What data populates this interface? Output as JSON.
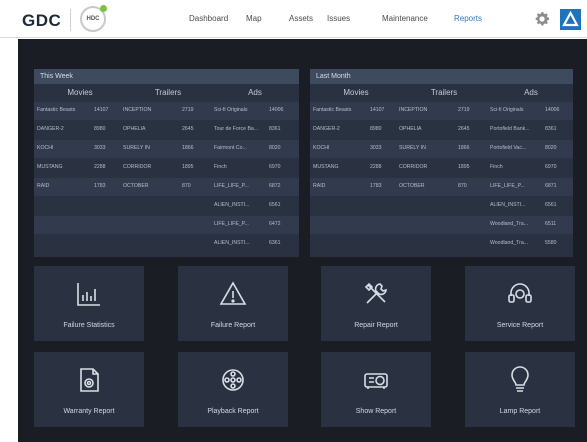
{
  "header": {
    "logo": "GDC",
    "badge": "HDC",
    "nav": [
      "Dashboard",
      "Map",
      "Assets",
      "Issues",
      "Maintenance",
      "Reports"
    ],
    "active_nav": "Reports"
  },
  "this_week": {
    "title": "This Week",
    "columns": [
      "Movies",
      "Trailers",
      "Ads"
    ],
    "rows": [
      [
        "Fantastic Beasts",
        "14107",
        "INCEPTION",
        "2719",
        "Sci-fi Originals",
        "14006"
      ],
      [
        "DANGER-2",
        "8980",
        "OPHELIA",
        "2645",
        "Tour de Force Ba...",
        "8361"
      ],
      [
        "KOCHI",
        "3033",
        "SURELY IN",
        "1866",
        "Fairmont Co...",
        "8020"
      ],
      [
        "MUSTANG",
        "2288",
        "CORRIDOR",
        "1895",
        "Finch",
        "6970"
      ],
      [
        "RAID",
        "1783",
        "OCTOBER",
        "870",
        "LIFE_LIFE_P...",
        "6872"
      ],
      [
        "",
        "",
        "",
        "",
        "ALIEN_INSTI...",
        "6561"
      ],
      [
        "",
        "",
        "",
        "",
        "LIFE_LIFE_P...",
        "6472"
      ],
      [
        "",
        "",
        "",
        "",
        "ALIEN_INSTI...",
        "6361"
      ]
    ]
  },
  "last_month": {
    "title": "Last Month",
    "columns": [
      "Movies",
      "Trailers",
      "Ads"
    ],
    "rows": [
      [
        "Fantastic Beasts",
        "14107",
        "INCEPTION",
        "2719",
        "Sci-fi Originals",
        "14006"
      ],
      [
        "DANGER-2",
        "8980",
        "OPHELIA",
        "2645",
        "Portofield Bank...",
        "8361"
      ],
      [
        "KOCHI",
        "3033",
        "SURELY IN",
        "1866",
        "Portofield Vac...",
        "8020"
      ],
      [
        "MUSTANG",
        "2288",
        "CORRIDOR",
        "1895",
        "Finch",
        "6970"
      ],
      [
        "RAID",
        "1783",
        "OCTOBER",
        "870",
        "LIFE_LIFE_P...",
        "6871"
      ],
      [
        "",
        "",
        "",
        "",
        "ALIEN_INSTI...",
        "6561"
      ],
      [
        "",
        "",
        "",
        "",
        "Woodland_Tra...",
        "6511"
      ],
      [
        "",
        "",
        "",
        "",
        "Woodland_Tra...",
        "5580"
      ]
    ]
  },
  "tiles": [
    {
      "label": "Failure Statistics",
      "icon": "bar-chart-icon"
    },
    {
      "label": "Failure Report",
      "icon": "warning-icon"
    },
    {
      "label": "Repair Report",
      "icon": "tools-icon"
    },
    {
      "label": "Service Report",
      "icon": "headset-icon"
    },
    {
      "label": "Warranty Report",
      "icon": "warranty-document-icon"
    },
    {
      "label": "Playback Report",
      "icon": "film-reel-icon"
    },
    {
      "label": "Show Report",
      "icon": "projector-icon"
    },
    {
      "label": "Lamp Report",
      "icon": "lightbulb-icon"
    }
  ]
}
